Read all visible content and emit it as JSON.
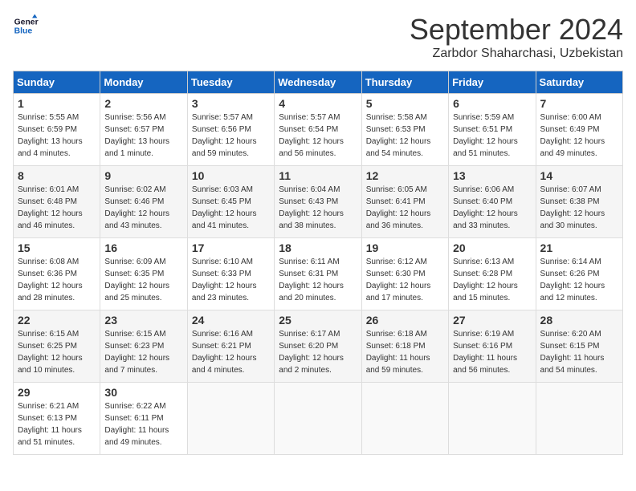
{
  "header": {
    "logo_line1": "General",
    "logo_line2": "Blue",
    "month": "September 2024",
    "location": "Zarbdor Shaharchasi, Uzbekistan"
  },
  "weekdays": [
    "Sunday",
    "Monday",
    "Tuesday",
    "Wednesday",
    "Thursday",
    "Friday",
    "Saturday"
  ],
  "weeks": [
    [
      {
        "day": 1,
        "sunrise": "5:55 AM",
        "sunset": "6:59 PM",
        "daylight": "13 hours and 4 minutes."
      },
      {
        "day": 2,
        "sunrise": "5:56 AM",
        "sunset": "6:57 PM",
        "daylight": "13 hours and 1 minute."
      },
      {
        "day": 3,
        "sunrise": "5:57 AM",
        "sunset": "6:56 PM",
        "daylight": "12 hours and 59 minutes."
      },
      {
        "day": 4,
        "sunrise": "5:57 AM",
        "sunset": "6:54 PM",
        "daylight": "12 hours and 56 minutes."
      },
      {
        "day": 5,
        "sunrise": "5:58 AM",
        "sunset": "6:53 PM",
        "daylight": "12 hours and 54 minutes."
      },
      {
        "day": 6,
        "sunrise": "5:59 AM",
        "sunset": "6:51 PM",
        "daylight": "12 hours and 51 minutes."
      },
      {
        "day": 7,
        "sunrise": "6:00 AM",
        "sunset": "6:49 PM",
        "daylight": "12 hours and 49 minutes."
      }
    ],
    [
      {
        "day": 8,
        "sunrise": "6:01 AM",
        "sunset": "6:48 PM",
        "daylight": "12 hours and 46 minutes."
      },
      {
        "day": 9,
        "sunrise": "6:02 AM",
        "sunset": "6:46 PM",
        "daylight": "12 hours and 43 minutes."
      },
      {
        "day": 10,
        "sunrise": "6:03 AM",
        "sunset": "6:45 PM",
        "daylight": "12 hours and 41 minutes."
      },
      {
        "day": 11,
        "sunrise": "6:04 AM",
        "sunset": "6:43 PM",
        "daylight": "12 hours and 38 minutes."
      },
      {
        "day": 12,
        "sunrise": "6:05 AM",
        "sunset": "6:41 PM",
        "daylight": "12 hours and 36 minutes."
      },
      {
        "day": 13,
        "sunrise": "6:06 AM",
        "sunset": "6:40 PM",
        "daylight": "12 hours and 33 minutes."
      },
      {
        "day": 14,
        "sunrise": "6:07 AM",
        "sunset": "6:38 PM",
        "daylight": "12 hours and 30 minutes."
      }
    ],
    [
      {
        "day": 15,
        "sunrise": "6:08 AM",
        "sunset": "6:36 PM",
        "daylight": "12 hours and 28 minutes."
      },
      {
        "day": 16,
        "sunrise": "6:09 AM",
        "sunset": "6:35 PM",
        "daylight": "12 hours and 25 minutes."
      },
      {
        "day": 17,
        "sunrise": "6:10 AM",
        "sunset": "6:33 PM",
        "daylight": "12 hours and 23 minutes."
      },
      {
        "day": 18,
        "sunrise": "6:11 AM",
        "sunset": "6:31 PM",
        "daylight": "12 hours and 20 minutes."
      },
      {
        "day": 19,
        "sunrise": "6:12 AM",
        "sunset": "6:30 PM",
        "daylight": "12 hours and 17 minutes."
      },
      {
        "day": 20,
        "sunrise": "6:13 AM",
        "sunset": "6:28 PM",
        "daylight": "12 hours and 15 minutes."
      },
      {
        "day": 21,
        "sunrise": "6:14 AM",
        "sunset": "6:26 PM",
        "daylight": "12 hours and 12 minutes."
      }
    ],
    [
      {
        "day": 22,
        "sunrise": "6:15 AM",
        "sunset": "6:25 PM",
        "daylight": "12 hours and 10 minutes."
      },
      {
        "day": 23,
        "sunrise": "6:15 AM",
        "sunset": "6:23 PM",
        "daylight": "12 hours and 7 minutes."
      },
      {
        "day": 24,
        "sunrise": "6:16 AM",
        "sunset": "6:21 PM",
        "daylight": "12 hours and 4 minutes."
      },
      {
        "day": 25,
        "sunrise": "6:17 AM",
        "sunset": "6:20 PM",
        "daylight": "12 hours and 2 minutes."
      },
      {
        "day": 26,
        "sunrise": "6:18 AM",
        "sunset": "6:18 PM",
        "daylight": "11 hours and 59 minutes."
      },
      {
        "day": 27,
        "sunrise": "6:19 AM",
        "sunset": "6:16 PM",
        "daylight": "11 hours and 56 minutes."
      },
      {
        "day": 28,
        "sunrise": "6:20 AM",
        "sunset": "6:15 PM",
        "daylight": "11 hours and 54 minutes."
      }
    ],
    [
      {
        "day": 29,
        "sunrise": "6:21 AM",
        "sunset": "6:13 PM",
        "daylight": "11 hours and 51 minutes."
      },
      {
        "day": 30,
        "sunrise": "6:22 AM",
        "sunset": "6:11 PM",
        "daylight": "11 hours and 49 minutes."
      },
      null,
      null,
      null,
      null,
      null
    ]
  ]
}
